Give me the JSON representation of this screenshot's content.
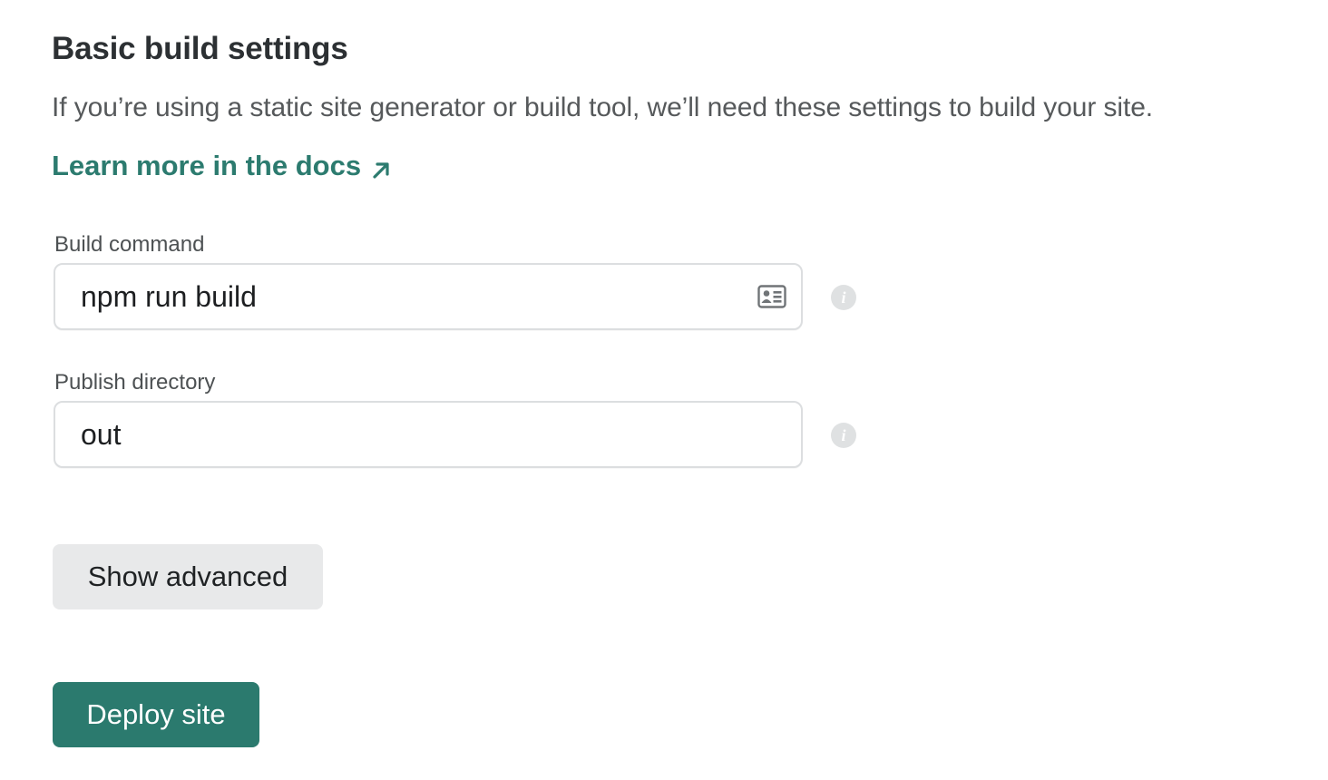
{
  "section": {
    "title": "Basic build settings",
    "description": "If you’re using a static site generator or build tool, we’ll need these settings to build your site.",
    "docs_link_label": "Learn more in the docs",
    "accent_color": "#2c7b6f"
  },
  "build_command": {
    "label": "Build command",
    "value": "npm run build",
    "icon": "contact-card-icon",
    "info_icon_glyph": "i"
  },
  "publish_directory": {
    "label": "Publish directory",
    "value": "out",
    "info_icon_glyph": "i"
  },
  "actions": {
    "show_advanced_label": "Show advanced",
    "deploy_label": "Deploy site"
  }
}
